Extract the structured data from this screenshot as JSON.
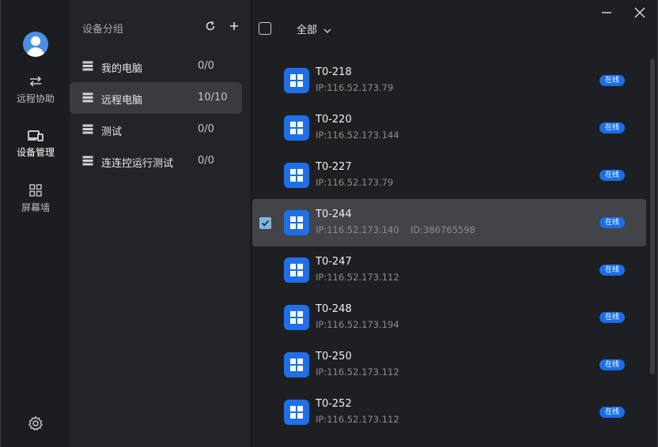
{
  "nav": {
    "items": [
      {
        "label": "远程协助",
        "icon": "transfer-arrows-icon"
      },
      {
        "label": "设备管理",
        "icon": "devices-icon"
      },
      {
        "label": "屏幕墙",
        "icon": "grid-icon"
      }
    ],
    "settings_icon": "gear-icon",
    "accent": "#4a90e2"
  },
  "groups": {
    "title": "设备分组",
    "items": [
      {
        "label": "我的电脑",
        "count": "0/0"
      },
      {
        "label": "远程电脑",
        "count": "10/10"
      },
      {
        "label": "测试",
        "count": "0/0"
      },
      {
        "label": "连连控运行测试",
        "count": "0/0"
      }
    ]
  },
  "main": {
    "filter_label": "全部",
    "devices": [
      {
        "name": "T0-218",
        "ip": "IP:116.52.173.79",
        "id": "",
        "status": "在线"
      },
      {
        "name": "T0-220",
        "ip": "IP:116.52.173.144",
        "id": "",
        "status": "在线"
      },
      {
        "name": "T0-227",
        "ip": "IP:116.52.173.79",
        "id": "",
        "status": "在线"
      },
      {
        "name": "T0-244",
        "ip": "IP:116.52.173.140",
        "id": "ID:386765598",
        "status": "在线"
      },
      {
        "name": "T0-247",
        "ip": "IP:116.52.173.112",
        "id": "",
        "status": "在线"
      },
      {
        "name": "T0-248",
        "ip": "IP:116.52.173.194",
        "id": "",
        "status": "在线"
      },
      {
        "name": "T0-250",
        "ip": "IP:116.52.173.112",
        "id": "",
        "status": "在线"
      },
      {
        "name": "T0-252",
        "ip": "IP:116.52.173.112",
        "id": "",
        "status": "在线"
      }
    ],
    "status_color": "#1a6ee8",
    "logo_color": "#1f6fe8"
  }
}
